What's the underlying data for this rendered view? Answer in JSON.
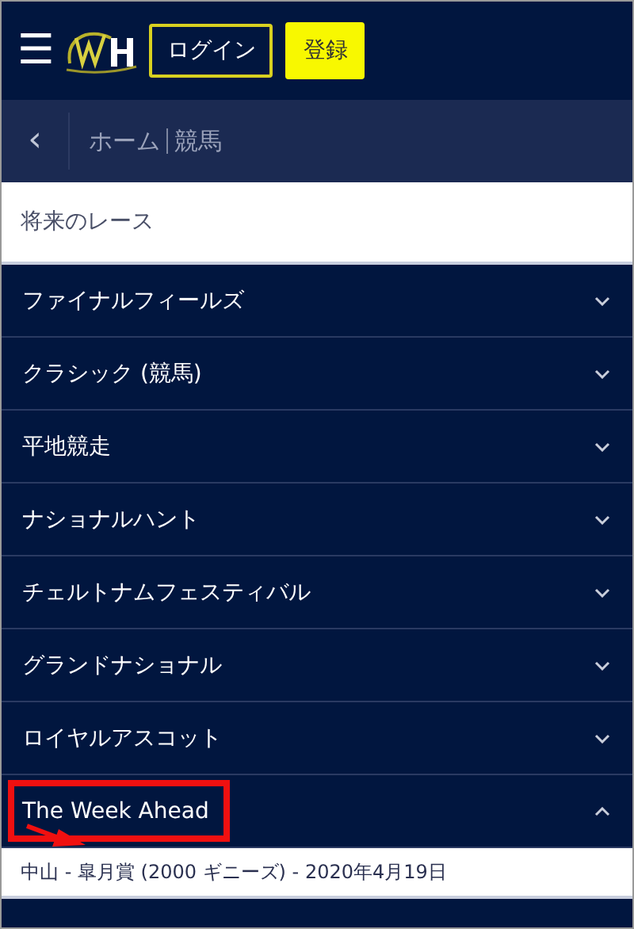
{
  "header": {
    "menu": "☰",
    "login_button": "ログイン",
    "register_button": "登録"
  },
  "breadcrumb": {
    "back": "‹",
    "items": [
      "ホーム",
      "競馬"
    ]
  },
  "section_title": "将来のレース",
  "sections": [
    {
      "label": "ファイナルフィールズ",
      "expanded": false,
      "highlighted": false
    },
    {
      "label": "クラシック (競馬)",
      "expanded": false,
      "highlighted": false
    },
    {
      "label": "平地競走",
      "expanded": false,
      "highlighted": false
    },
    {
      "label": "ナショナルハント",
      "expanded": false,
      "highlighted": false
    },
    {
      "label": "チェルトナムフェスティバル",
      "expanded": false,
      "highlighted": false
    },
    {
      "label": "グランドナショナル",
      "expanded": false,
      "highlighted": false
    },
    {
      "label": "ロイヤルアスコット",
      "expanded": false,
      "highlighted": false
    },
    {
      "label": "The Week Ahead",
      "expanded": true,
      "highlighted": true,
      "children": [
        "中山 - 皐月賞 (2000 ギニーズ) - 2020年4月19日"
      ]
    }
  ]
}
